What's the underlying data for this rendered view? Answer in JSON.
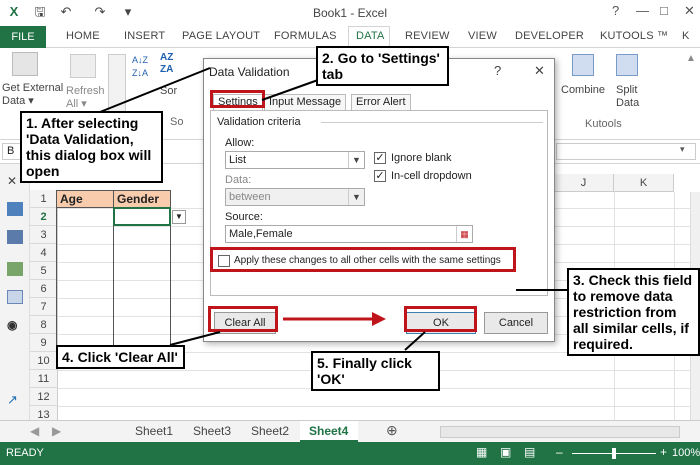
{
  "app": {
    "title": "Book1 - Excel",
    "controls": [
      "?",
      "—",
      "□",
      "✕"
    ],
    "tabs": [
      "FILE",
      "HOME",
      "INSERT",
      "PAGE LAYOUT",
      "FORMULAS",
      "DATA",
      "REVIEW",
      "VIEW",
      "DEVELOPER",
      "KUTOOLS ™",
      "K"
    ]
  },
  "ribbon": {
    "get_external": "Get External",
    "data_label": "Data",
    "refresh": "Refresh",
    "all": "All",
    "sort": "Sor",
    "combine": "Combine",
    "split": "Split",
    "split2": "Data",
    "kutools_group": "Kutools",
    "so_label": "So"
  },
  "grid": {
    "rows": [
      "1",
      "2",
      "3",
      "4",
      "5",
      "6",
      "7",
      "8",
      "9",
      "10",
      "11",
      "12",
      "13"
    ],
    "col_j": "J",
    "col_k": "K",
    "header_age": "Age",
    "header_gender": "Gender"
  },
  "sheets": [
    "Sheet1",
    "Sheet3",
    "Sheet2",
    "Sheet4"
  ],
  "status": {
    "left": "READY",
    "zoom": "100%"
  },
  "dialog": {
    "title": "Data Validation",
    "help": "?",
    "close": "✕",
    "tabs": [
      "Settings",
      "Input Message",
      "Error Alert"
    ],
    "criteria": "Validation criteria",
    "allow_label": "Allow:",
    "allow_value": "List",
    "data_label": "Data:",
    "data_value": "between",
    "ignore_blank": "Ignore blank",
    "incell": "In-cell dropdown",
    "source_label": "Source:",
    "source_value": "Male,Female",
    "apply_all": "Apply these changes to all other cells with the same settings",
    "clear_all": "Clear All",
    "ok": "OK",
    "cancel": "Cancel"
  },
  "annotations": {
    "n1": "1. After selecting 'Data Validation, this dialog box will open",
    "n2": "2. Go to 'Settings' tab",
    "n3": "3. Check this field to remove data restriction from all similar cells, if required.",
    "n4": "4. Click 'Clear All'",
    "n5": "5. Finally click 'OK'"
  }
}
